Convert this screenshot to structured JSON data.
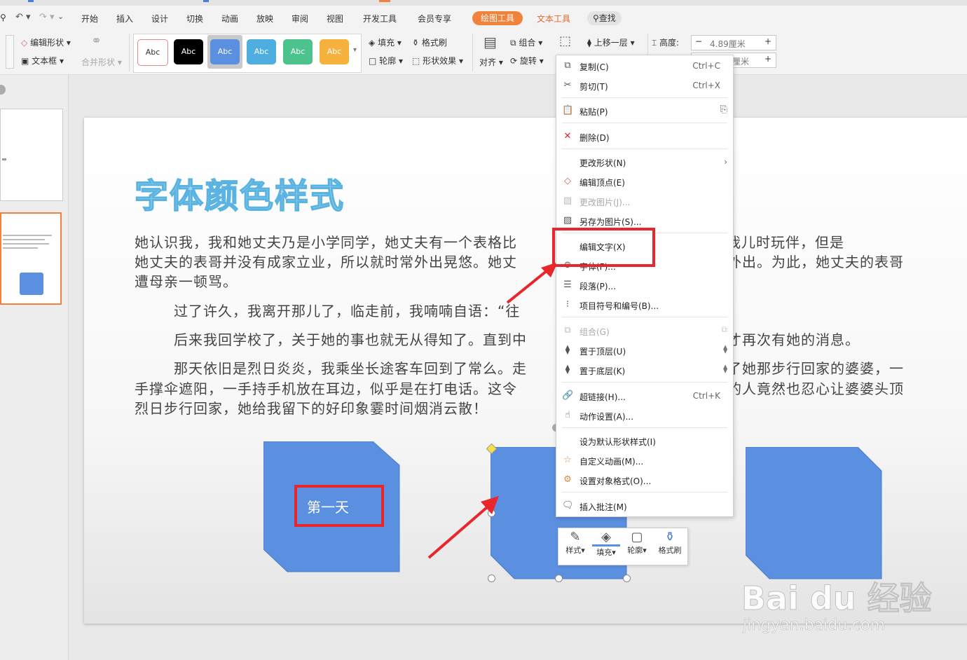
{
  "menubar": {
    "tabs": [
      "开始",
      "插入",
      "设计",
      "切换",
      "动画",
      "放映",
      "审阅",
      "视图",
      "开发工具",
      "会员专享"
    ],
    "drawing_tools": "绘图工具",
    "text_tools": "文本工具",
    "search": "查找"
  },
  "ribbon": {
    "edit_shape": "编辑形状",
    "text_box": "文本框",
    "merge_shape": "合并形状",
    "style_swatch_label": "Abc",
    "fill": "填充",
    "format_brush": "格式刷",
    "outline": "轮廓",
    "shape_effect": "形状效果",
    "align": "对齐",
    "group": "组合",
    "rotate": "旋转",
    "bring_forward": "上移一层",
    "height_label": "高度:",
    "height_value": "4.89厘米",
    "width_value_partial": "厘米",
    "colors": [
      "#ffffff",
      "#000000",
      "#5b8fe0",
      "#4eaee0",
      "#4cc28c",
      "#f6b23c"
    ]
  },
  "slide": {
    "title": "字体颜色样式",
    "p1_line1": "她认识我，我和她丈夫乃是小学同学，她丈夫有一个表格比",
    "p1_line1_right": "邻居，也是我儿时玩伴，但是",
    "p1_line2": "她丈夫的表哥并没有成家立业，所以就时常外出晃悠。她丈",
    "p1_line2_right": "外出。为此，她丈夫的表哥",
    "p1_line3": "遭母亲一顿骂。",
    "p2": "过了许久，我离开那儿了，临走前，我喃喃自语：“往",
    "p3": "后来我回学校了，关于她的事也就无从得知了。直到中",
    "p3_right": "才再次有她的消息。",
    "p4_line1": "那天依旧是烈日炎炎，我乘坐长途客车回到了常么。走",
    "p4_line1_right": "了她那步行回家的婆婆，一",
    "p4_line2": "手撑伞遮阳，一手持手机放在耳边，似乎是在打电话。这令",
    "p4_line2_right": "的人竟然也忍心让婆婆头顶",
    "p4_line3": "烈日步行回家，她给我留下的好印象霎时间烟消云散！",
    "shape1_text": "第一天",
    "shape_color": "#5b8fe0"
  },
  "context_menu": {
    "items": [
      {
        "label": "复制(C)",
        "shortcut": "Ctrl+C"
      },
      {
        "label": "剪切(T)",
        "shortcut": "Ctrl+X"
      },
      {
        "label": "粘贴(P)",
        "shortcut": ""
      },
      {
        "label": "删除(D)",
        "shortcut": ""
      },
      {
        "label": "更改形状(N)",
        "shortcut": ""
      },
      {
        "label": "编辑顶点(E)",
        "shortcut": ""
      },
      {
        "label": "更改图片(J)...",
        "shortcut": ""
      },
      {
        "label": "另存为图片(S)...",
        "shortcut": ""
      },
      {
        "label": "编辑文字(X)",
        "shortcut": ""
      },
      {
        "label": "字体(F)...",
        "shortcut": ""
      },
      {
        "label": "段落(P)...",
        "shortcut": ""
      },
      {
        "label": "项目符号和编号(B)...",
        "shortcut": ""
      },
      {
        "label": "组合(G)",
        "shortcut": ""
      },
      {
        "label": "置于顶层(U)",
        "shortcut": ""
      },
      {
        "label": "置于底层(K)",
        "shortcut": ""
      },
      {
        "label": "超链接(H)...",
        "shortcut": "Ctrl+K"
      },
      {
        "label": "动作设置(A)...",
        "shortcut": ""
      },
      {
        "label": "设为默认形状样式(I)",
        "shortcut": ""
      },
      {
        "label": "自定义动画(M)...",
        "shortcut": ""
      },
      {
        "label": "设置对象格式(O)...",
        "shortcut": ""
      },
      {
        "label": "插入批注(M)",
        "shortcut": ""
      }
    ]
  },
  "mini_toolbar": {
    "style": "样式",
    "fill": "填充",
    "outline": "轮廓",
    "brush": "格式刷"
  },
  "watermark": {
    "brand": "Bai du 经验",
    "url": "jingyan.baidu.com"
  },
  "accent": {
    "red": "#e8262b",
    "orange": "#f0823c"
  }
}
